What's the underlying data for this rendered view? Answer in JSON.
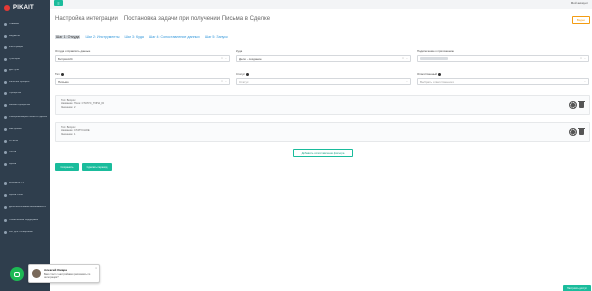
{
  "app": {
    "logo_text": "PIKAIT",
    "user_label": "Мой аккаунт",
    "menu_toggle": "≡"
  },
  "sidebar": {
    "items": [
      {
        "label": "Главная"
      },
      {
        "label": "Виджеты"
      },
      {
        "label": "Интеграции"
      },
      {
        "label": "Триггеры"
      },
      {
        "label": "Доступы"
      },
      {
        "label": "Рабочий процесс"
      },
      {
        "label": "Процессы"
      },
      {
        "label": "Бизнес-процессы"
      },
      {
        "label": "Синхронизация полей и сделок",
        "two": true
      },
      {
        "label": "Настройки"
      },
      {
        "label": "Отчеты"
      },
      {
        "label": "Почта"
      },
      {
        "label": "Архив"
      }
    ],
    "bottom_items": [
      {
        "label": "Контакты Г1"
      },
      {
        "label": "Архив CRM"
      },
      {
        "label": "Дополнительные возможности",
        "two": true
      },
      {
        "label": "Техническая поддержка",
        "two": true
      },
      {
        "label": "API для Телефонии"
      }
    ]
  },
  "page": {
    "title": "Настройка интеграции",
    "subtitle": "Постановка задачи при получении Письма в Сделке",
    "help_button": "Видео",
    "steps": [
      {
        "label": "Шаг 1: Откуда",
        "active": true
      },
      {
        "label": "Шаг 2: Инструменты"
      },
      {
        "label": "Шаг 3: Куда"
      },
      {
        "label": "Шаг 4: Сопоставление данных"
      },
      {
        "label": "Шаг 5: Запуск"
      }
    ],
    "fields": {
      "source": {
        "label": "Откуда отправлять данные",
        "value": "Битрикс24"
      },
      "where": {
        "label": "Куда",
        "value": "Дело - создание"
      },
      "connection": {
        "label": "Подключение к приложению"
      },
      "type": {
        "label": "Тип",
        "value": "Письмо"
      },
      "status": {
        "label": "Статус",
        "placeholder": "Статус"
      },
      "responsible": {
        "label": "Ответственный",
        "placeholder": "Выбрать ответственного"
      }
    },
    "conditions": [
      {
        "lines": [
          "Тип: Вопрос",
          "Название: Поле: СТАТУС_ТИПА_ID",
          "Значение: 2"
        ]
      },
      {
        "lines": [
          "Тип: Вопрос",
          "Название: СТАТУСНОЕ",
          "Значение: 1"
        ]
      }
    ],
    "add_condition": "Добавить сопоставление фильтра",
    "save_button": "Сохранить",
    "continue_button": "Сделать переход",
    "corner_button": "Настроить доступ"
  },
  "chat": {
    "name": "Алексей Омара",
    "message": "Вам стоит с настройками рассказать по интеграции?",
    "close": "×"
  },
  "colors": {
    "accent": "#1abc9c",
    "sidebar": "#2f3e4d",
    "link": "#3498db",
    "warning": "#f39c12"
  }
}
